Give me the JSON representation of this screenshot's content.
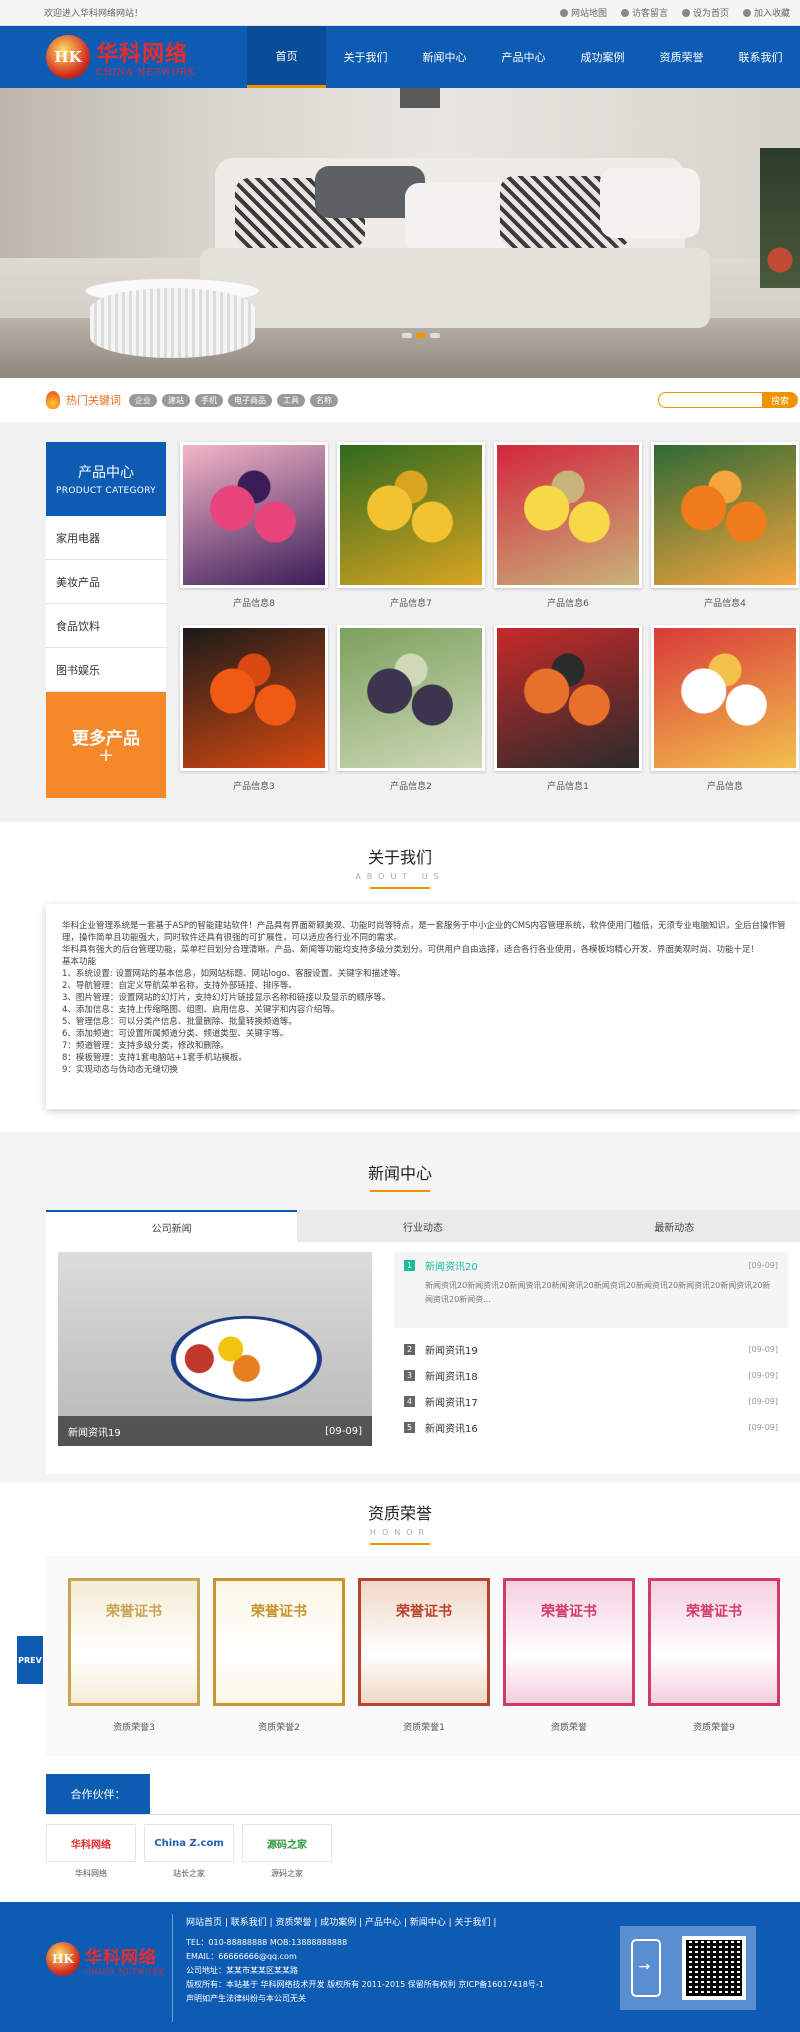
{
  "topbar": {
    "welcome": "欢迎进入华科网络网站！",
    "links": [
      {
        "label": "网站地图",
        "icon": "sitemap-icon"
      },
      {
        "label": "访客留言",
        "icon": "message-icon"
      },
      {
        "label": "设为首页",
        "icon": "home-icon"
      },
      {
        "label": "加入收藏",
        "icon": "star-icon"
      }
    ]
  },
  "logo": {
    "mark": "HK",
    "cn": "华科网络",
    "en": "CHINA NETWORK"
  },
  "nav": [
    "首页",
    "关于我们",
    "新闻中心",
    "产品中心",
    "成功案例",
    "资质荣誉",
    "联系我们"
  ],
  "banner": {
    "slides": 3,
    "active": 1
  },
  "hot": {
    "title": "热门关键词",
    "keywords": [
      "企业",
      "建站",
      "手机",
      "电子商品",
      "工具",
      "名称"
    ],
    "search_button": "搜索",
    "search_value": ""
  },
  "product_side": {
    "title": "产品中心",
    "subtitle": "PRODUCT CATEGORY",
    "items": [
      "家用电器",
      "美妆产品",
      "食品饮料",
      "图书娱乐"
    ],
    "more": "更多产品",
    "more_icon": "+"
  },
  "products": [
    {
      "name": "产品信息8",
      "colors": [
        "#e8447c",
        "#f4b6c8",
        "#3a1d58"
      ]
    },
    {
      "name": "产品信息7",
      "colors": [
        "#f2c230",
        "#2f6a1f",
        "#d9a520"
      ]
    },
    {
      "name": "产品信息6",
      "colors": [
        "#f7d948",
        "#d3263d",
        "#c8b37a"
      ]
    },
    {
      "name": "产品信息4",
      "colors": [
        "#f07b1a",
        "#2e6a35",
        "#f5a53d"
      ]
    },
    {
      "name": "产品信息3",
      "colors": [
        "#f05a14",
        "#1a1a1a",
        "#d94a10"
      ]
    },
    {
      "name": "产品信息2",
      "colors": [
        "#3b3550",
        "#7ca05c",
        "#cfd9b8"
      ]
    },
    {
      "name": "产品信息1",
      "colors": [
        "#e8702a",
        "#c62a2a",
        "#2b2b2b"
      ]
    },
    {
      "name": "产品信息",
      "colors": [
        "#ffffff",
        "#d83a3a",
        "#f3c04c"
      ]
    }
  ],
  "about": {
    "title": "关于我们",
    "en": "ABOUT US",
    "lines": [
      "华科企业管理系统是一套基于ASP的智能建站软件！产品具有界面新颖美观、功能时尚等特点，是一套服务于中小企业的CMS内容管理系统，软件使用门槛低，无须专业电脑知识，全后台操作管理，操作简单且功能强大，同时软件还具有很强的可扩展性，可以适应各行业不同的需求。",
      "华科具有强大的后台管理功能，菜单栏目划分合理清晰。产品、新闻等功能均支持多级分类划分。可供用户自由选择，适合各行各业使用，各模板均精心开发、界面美观时尚、功能十足！",
      "基本功能",
      "1、系统设置: 设置网站的基本信息，如网站标题、网站logo、客服设置、关键字和描述等。",
      "2、导航管理：自定义导航菜单名称，支持外部链接、排序等。",
      "3、图片管理：设置网站的幻灯片，支持幻灯片链接显示名称和链接以及显示的顺序等。",
      "4、添加信息：支持上传缩略图、组图、启用信息、关键字和内容介绍等。",
      "5、管理信息：可以分类产信息、批量删除、批量转换频道等。",
      "6、添加频道：可设置所属频道分类、频道类型、关键字等。",
      "7：频道管理：支持多级分类，修改和删除。",
      "8：模板管理：支持1套电脑站+1套手机站模板。",
      "9：实现动态与伪动态无缝切换"
    ]
  },
  "news": {
    "title": "新闻中心",
    "tabs": [
      "公司新闻",
      "行业动态",
      "最新动态"
    ],
    "feature": {
      "title": "新闻资讯19",
      "date": "[09-09]"
    },
    "first": {
      "num": "1",
      "title": "新闻资讯20",
      "date": "[09-09]",
      "summary": "新闻资讯20新闻资讯20新闻资讯20新闻资讯20新闻资讯20新闻资讯20新闻资讯20新闻资讯20新闻资讯20新闻资..."
    },
    "items": [
      {
        "num": "2",
        "title": "新闻资讯19",
        "date": "[09-09]"
      },
      {
        "num": "3",
        "title": "新闻资讯18",
        "date": "[09-09]"
      },
      {
        "num": "4",
        "title": "新闻资讯17",
        "date": "[09-09]"
      },
      {
        "num": "5",
        "title": "新闻资讯16",
        "date": "[09-09]"
      }
    ]
  },
  "honor": {
    "title": "资质荣誉",
    "en": "HONOR",
    "items": [
      {
        "name": "资质荣誉3",
        "cert": "荣誉证书",
        "bg": "#f4ecd6",
        "ink": "#c9a453"
      },
      {
        "name": "资质荣誉2",
        "cert": "荣誉证书",
        "bg": "#fbf7e4",
        "ink": "#c8932b"
      },
      {
        "name": "资质荣誉1",
        "cert": "荣誉证书",
        "bg": "#f0d7c4",
        "ink": "#b8432c"
      },
      {
        "name": "资质荣誉",
        "cert": "荣誉证书",
        "bg": "#f5cfe0",
        "ink": "#d33a6b"
      },
      {
        "name": "资质荣誉9",
        "cert": "荣誉证书",
        "bg": "#f5cfe0",
        "ink": "#d33a6b"
      }
    ],
    "prev": "PREV"
  },
  "partners": {
    "title": "合作伙伴：",
    "items": [
      {
        "name": "华科网络",
        "logo": "华科网络",
        "color": "#e52d2d"
      },
      {
        "name": "站长之家",
        "logo": "China Z.com",
        "color": "#1f5fb5"
      },
      {
        "name": "源码之家",
        "logo": "源码之家",
        "color": "#2e9b3d"
      }
    ]
  },
  "footer": {
    "nav": "网站首页 | 联系我们 | 资质荣誉 | 成功案例 | 产品中心 | 新闻中心 | 关于我们 |",
    "lines": [
      "TEL：010-88888888 MOB:13888888888",
      "EMAIL：66666666@qq.com",
      "公司地址：某某市某某区某某路",
      "版权所有：本站基于 华科网络技术开发 版权所有 2011-2015 保留所有权利 京ICP备16017418号-1",
      "声明如产生法律纠纷与本公司无关"
    ]
  }
}
